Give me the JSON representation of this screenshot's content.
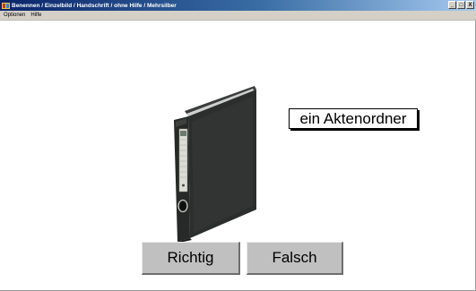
{
  "window": {
    "title": "Benennen / Einzelbild / Handschrift / ohne Hilfe / Mehrsilber",
    "controls": [
      "_",
      "□",
      "X"
    ]
  },
  "menu": {
    "items": [
      "Optionen",
      "Hilfe"
    ]
  },
  "main": {
    "picture_icon": "binder-image",
    "word": "ein Aktenordner",
    "buttons": {
      "correct": "Richtig",
      "wrong": "Falsch"
    }
  },
  "colors": {
    "titlebar_start": "#0a246a",
    "titlebar_end": "#a6caf0",
    "button_face": "#c0c0c0",
    "binder": "#2c2f2d"
  }
}
